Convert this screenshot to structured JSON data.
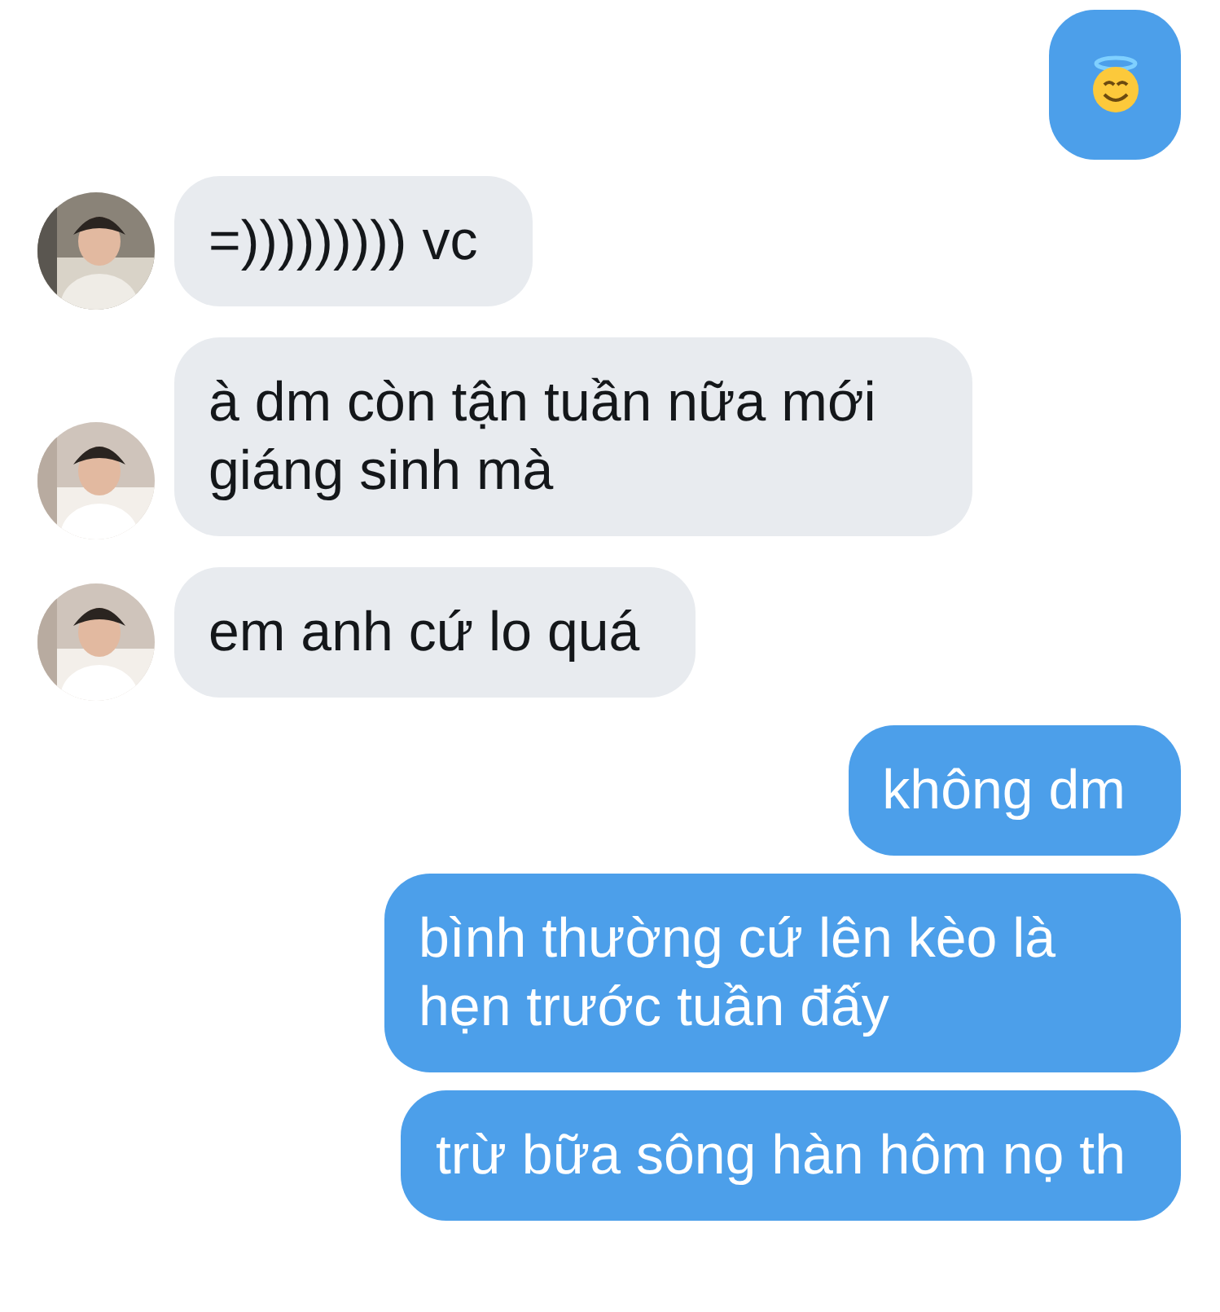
{
  "messages": [
    {
      "kind": "outgoing_emoji"
    },
    {
      "kind": "incoming_text",
      "text": "=))))))))) vc"
    },
    {
      "kind": "incoming_text",
      "text": "à dm còn tận tuần nữa mới giáng sinh mà"
    },
    {
      "kind": "incoming_text",
      "text": "em anh cứ lo quá"
    },
    {
      "kind": "outgoing_text",
      "text": "không dm"
    },
    {
      "kind": "outgoing_text",
      "text": "bình thường cứ lên kèo là hẹn trước tuần đấy"
    },
    {
      "kind": "outgoing_text",
      "text": "trừ bữa sông hàn hôm nọ th"
    }
  ]
}
